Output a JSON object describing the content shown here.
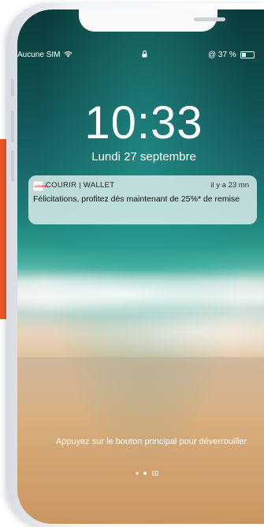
{
  "status_bar": {
    "carrier": "Aucune SIM",
    "battery_text": "@ 37 %",
    "battery_level": 0.37,
    "wifi_icon": "wifi-icon",
    "lock_icon": "lock-icon"
  },
  "lock_screen": {
    "time": "10:33",
    "date": "Lundi 27 septembre",
    "unlock_hint": "Appuyez sur le bouton principal pour déverrouiller"
  },
  "notification": {
    "app_name": "COURIR | WALLET",
    "app_icon_label": "COURIR",
    "time_ago": "il y a 23 mn",
    "message": "Félicitations, profitez dès maintenant de 25%* de remise"
  },
  "page_indicator": {
    "active_index": 1,
    "camera_icon": "camera-icon"
  },
  "colors": {
    "brand_orange": "#f05a28",
    "courir_red": "#e2231a"
  }
}
